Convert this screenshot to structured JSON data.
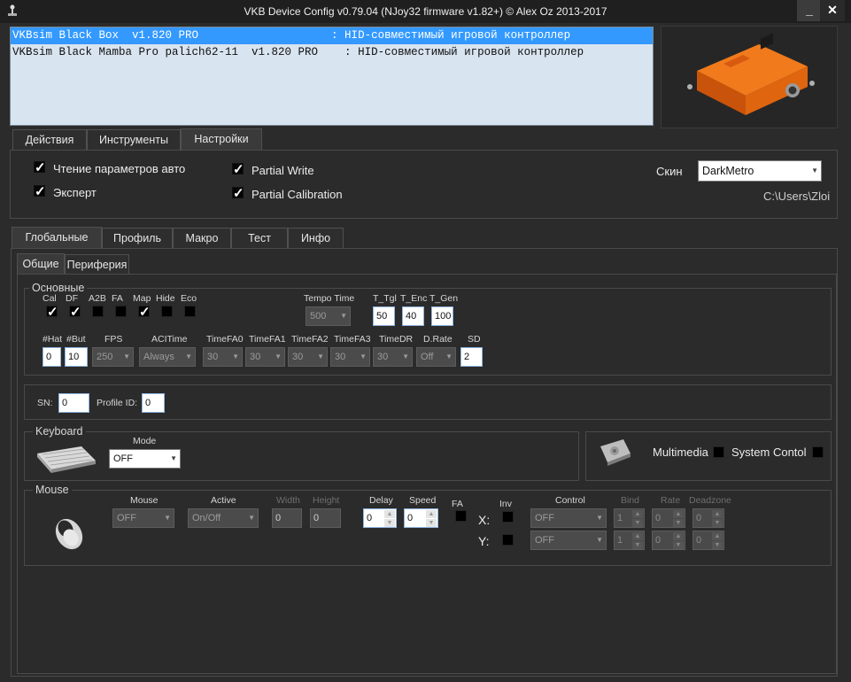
{
  "window": {
    "title": "VKB Device Config v0.79.04 (NJoy32 firmware v1.82+) © Alex Oz 2013-2017",
    "minimize_glyph": "_",
    "close_glyph": "✕",
    "icon": "joystick-icon"
  },
  "devices": [
    {
      "text": "VKBsim Black Box  v1.820 PRO                    : HID-совместимый игровой контроллер",
      "selected": true
    },
    {
      "text": "VKBsim Black Mamba Pro palich62-11  v1.820 PRO    : HID-совместимый игровой контроллер",
      "selected": false
    }
  ],
  "main_tabs": [
    "Действия",
    "Инструменты",
    "Настройки"
  ],
  "settings": {
    "read_params_auto": "Чтение параметров авто",
    "expert": "Эксперт",
    "partial_write": "Partial Write",
    "partial_calibration": "Partial Calibration",
    "skin_label": "Скин",
    "skin_value": "DarkMetro",
    "path": "C:\\Users\\Zloi"
  },
  "sub_tabs": [
    "Глобальные",
    "Профиль",
    "Макро",
    "Тест",
    "Инфо"
  ],
  "inner_tabs": [
    "Общие",
    "Периферия"
  ],
  "basic": {
    "legend": "Основные",
    "flags": [
      {
        "label": "Cal",
        "checked": true
      },
      {
        "label": "DF",
        "checked": true
      },
      {
        "label": "A2B",
        "checked": false
      },
      {
        "label": "FA",
        "checked": false
      },
      {
        "label": "Map",
        "checked": true
      },
      {
        "label": "Hide",
        "checked": false
      },
      {
        "label": "Eco",
        "checked": false
      }
    ],
    "tempo_label": "Tempo Time",
    "tempo_value": "500",
    "t_tgl_label": "T_Tgl",
    "t_tgl_value": "50",
    "t_enc_label": "T_Enc",
    "t_enc_value": "40",
    "t_gen_label": "T_Gen",
    "t_gen_value": "100",
    "hat_label": "#Hat",
    "hat_value": "0",
    "but_label": "#But",
    "but_value": "10",
    "fps_label": "FPS",
    "fps_value": "250",
    "acl_label": "ACITime",
    "acl_value": "Always",
    "tfa0_label": "TimeFA0",
    "tfa0_value": "30",
    "tfa1_label": "TimeFA1",
    "tfa1_value": "30",
    "tfa2_label": "TimeFA2",
    "tfa2_value": "30",
    "tfa3_label": "TimeFA3",
    "tfa3_value": "30",
    "tdr_label": "TimeDR",
    "tdr_value": "30",
    "drate_label": "D.Rate",
    "drate_value": "Off",
    "sd_label": "SD",
    "sd_value": "2"
  },
  "serial": {
    "sn_label": "SN:",
    "sn_value": "0",
    "profile_label": "Profile ID:",
    "profile_value": "0"
  },
  "keyboard": {
    "legend": "Keyboard",
    "mode_label": "Mode",
    "mode_value": "OFF",
    "icon": "keyboard-icon"
  },
  "multimedia": {
    "icon": "multimedia-icon",
    "multimedia_label": "Multimedia",
    "system_label": "System Contol"
  },
  "mouse": {
    "legend": "Mouse",
    "icon": "mouse-icon",
    "mouse_label": "Mouse",
    "mouse_value": "OFF",
    "active_label": "Active",
    "active_value": "On/Off",
    "width_label": "Width",
    "width_value": "0",
    "height_label": "Height",
    "height_value": "0",
    "delay_label": "Delay",
    "delay_value": "0",
    "speed_label": "Speed",
    "speed_value": "0",
    "fa_label": "FA",
    "inv_label": "Inv",
    "x_label": "X:",
    "y_label": "Y:",
    "control_label": "Control",
    "control_x": "OFF",
    "control_y": "OFF",
    "bind_label": "Bind",
    "bind_x": "1",
    "bind_y": "1",
    "rate_label": "Rate",
    "rate_x": "0",
    "rate_y": "0",
    "deadzone_label": "Deadzone",
    "deadzone_x": "0",
    "deadzone_y": "0"
  },
  "colors": {
    "accent": "#3399ff",
    "background": "#2b2b2b",
    "device_orange": "#e8620c"
  }
}
